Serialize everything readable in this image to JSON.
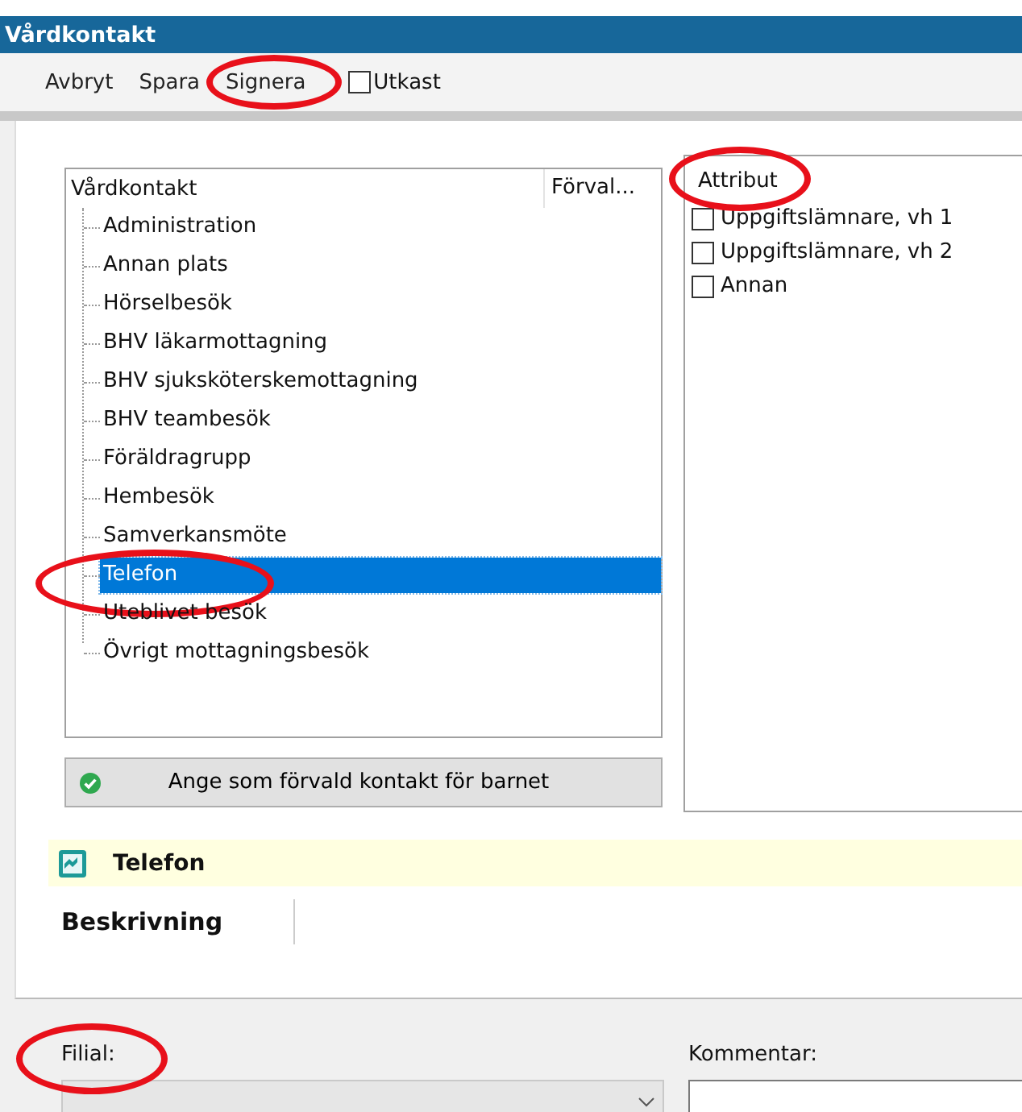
{
  "window": {
    "title": "Vårdkontakt"
  },
  "toolbar": {
    "buttons": [
      {
        "label": "Avbryt",
        "circled": false
      },
      {
        "label": "Spara",
        "circled": false
      },
      {
        "label": "Signera",
        "circled": true
      }
    ],
    "draft_checkbox": {
      "label": "Utkast",
      "checked": false
    }
  },
  "contact_tree": {
    "columns": [
      "Vårdkontakt",
      "Förval..."
    ],
    "items": [
      {
        "label": "Administration",
        "selected": false,
        "circled": false
      },
      {
        "label": "Annan plats",
        "selected": false,
        "circled": false
      },
      {
        "label": "Hörselbesök",
        "selected": false,
        "circled": false
      },
      {
        "label": "BHV läkarmottagning",
        "selected": false,
        "circled": false
      },
      {
        "label": "BHV sjuksköterskemottagning",
        "selected": false,
        "circled": false
      },
      {
        "label": "BHV teambesök",
        "selected": false,
        "circled": false
      },
      {
        "label": "Föräldragrupp",
        "selected": false,
        "circled": false
      },
      {
        "label": "Hembesök",
        "selected": false,
        "circled": false
      },
      {
        "label": "Samverkansmöte",
        "selected": false,
        "circled": false
      },
      {
        "label": "Telefon",
        "selected": true,
        "circled": true
      },
      {
        "label": "Uteblivet besök",
        "selected": false,
        "circled": false
      },
      {
        "label": "Övrigt mottagningsbesök",
        "selected": false,
        "circled": false
      }
    ]
  },
  "default_button": {
    "label": "Ange som förvald kontakt för barnet"
  },
  "attributes": {
    "title": "Attribut",
    "circled": true,
    "items": [
      {
        "label": "Uppgiftslämnare, vh 1",
        "checked": false
      },
      {
        "label": "Uppgiftslämnare, vh 2",
        "checked": false
      },
      {
        "label": "Annan",
        "checked": false
      }
    ]
  },
  "detail": {
    "title": "Telefon",
    "description_label": "Beskrivning"
  },
  "branch": {
    "label": "Filial:",
    "circled": true
  },
  "comment": {
    "label": "Kommentar:"
  }
}
